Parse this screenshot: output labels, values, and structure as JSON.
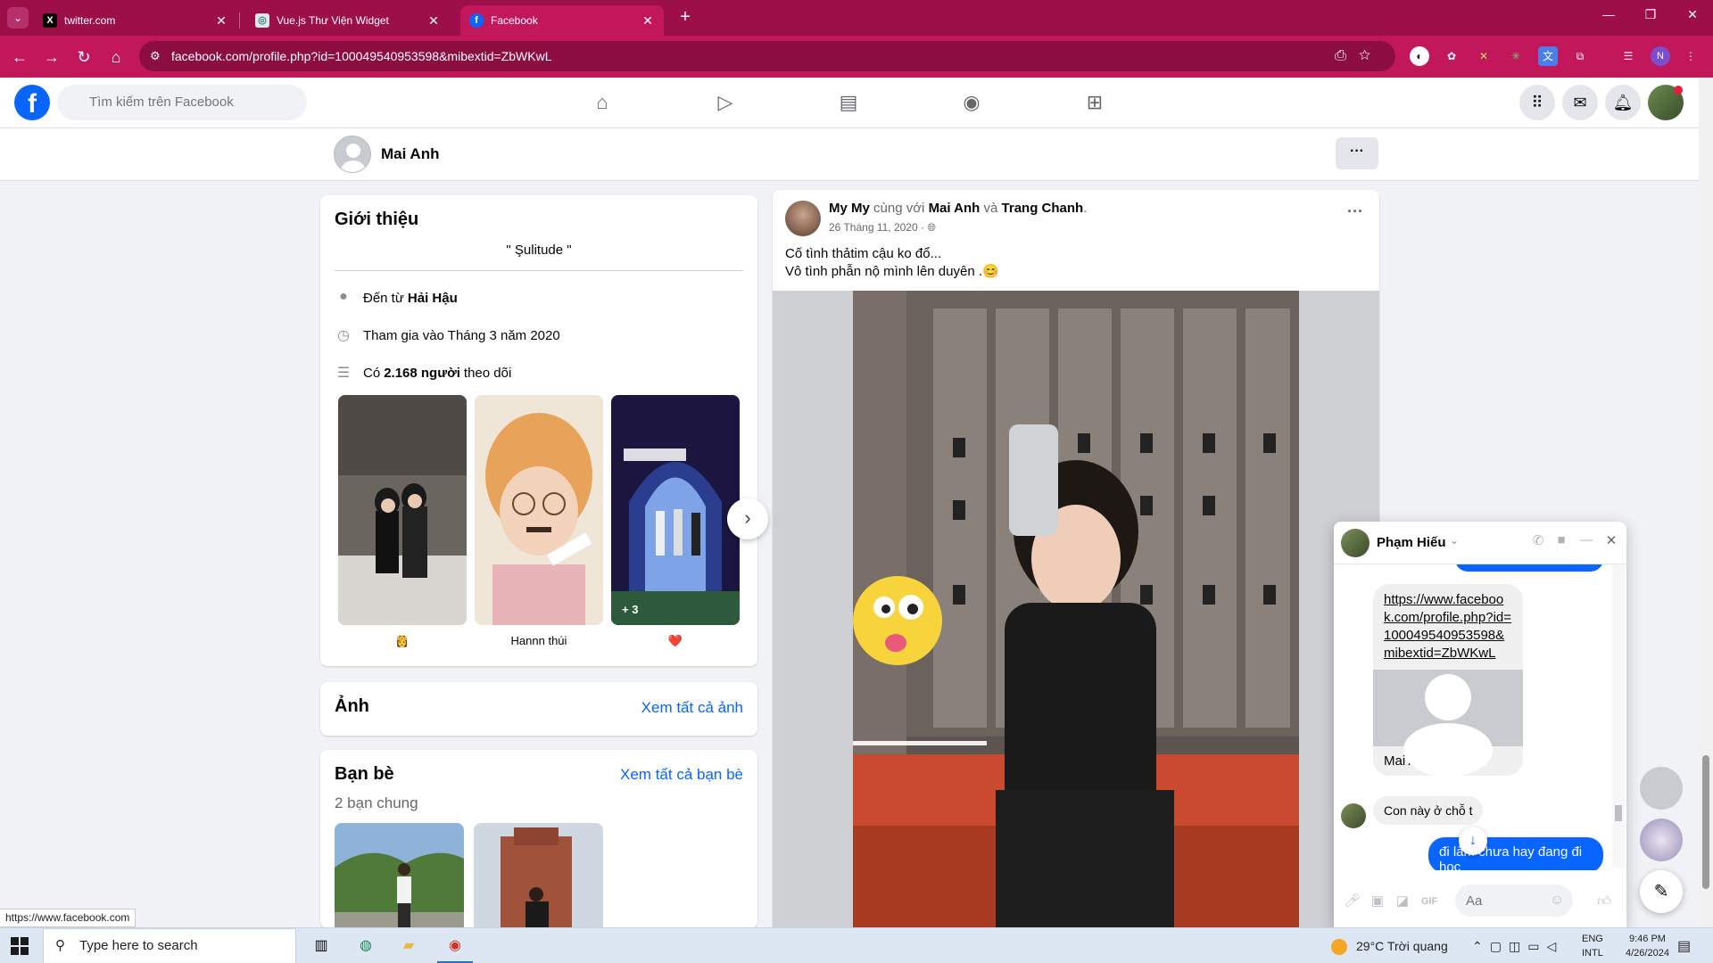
{
  "browser": {
    "tabs": [
      {
        "title": "twitter.com",
        "favicon": "x-icon"
      },
      {
        "title": "Vue.js Thư Viện Widget",
        "favicon": "vue-icon"
      },
      {
        "title": "Facebook",
        "favicon": "facebook-icon",
        "active": true
      }
    ],
    "url": "facebook.com/profile.php?id=100049540953598&mibextid=ZbWKwL",
    "profile_initial": "N",
    "status_url": "https://www.facebook.com",
    "accent": "#c2185b"
  },
  "fb": {
    "search_placeholder": "Tìm kiếm trên Facebook",
    "nav_icons": [
      "home-icon",
      "video-icon",
      "marketplace-icon",
      "groups-icon",
      "gaming-icon"
    ],
    "accent": "#0866ff"
  },
  "profile": {
    "name": "Mai Anh"
  },
  "intro": {
    "title": "Giới thiệu",
    "bio": "\" Şulitude \"",
    "from_prefix": "Đến từ",
    "from_place": "Hải Hậu",
    "joined": "Tham gia vào Tháng 3 năm 2020",
    "followers_prefix": "Có",
    "followers_count": "2.168 người",
    "followers_suffix": "theo dõi",
    "featured": [
      {
        "caption": "👸"
      },
      {
        "caption": "Hannn thúi"
      },
      {
        "caption": "❤️",
        "more": "+ 3"
      }
    ]
  },
  "photos": {
    "title": "Ảnh",
    "see_all": "Xem tất cả ảnh"
  },
  "friends": {
    "title": "Bạn bè",
    "mutual": "2 bạn chung",
    "see_all": "Xem tất cả bạn bè"
  },
  "post": {
    "author": "My My",
    "with_text": "cùng với",
    "tag1": "Mai Anh",
    "and_text": "và",
    "tag2": "Trang Chanh",
    "date": "26 Tháng 11, 2020 ·",
    "line1": "Cố tình thảtim cậu ko đổ...",
    "line2": "Vô tình phẫn nộ mình lên duyên .😊"
  },
  "chat": {
    "contact": "Phạm Hiếu",
    "link_url": "https://www.facebook.com/profile.php?id=100049540953598&mibextid=ZbWKwL",
    "link_name": "Mai Anh",
    "received": "Con này ở chỗ t",
    "sent": "đi làm chưa hay đang đi học",
    "input_placeholder": "Aa"
  },
  "taskbar": {
    "search_placeholder": "Type here to search",
    "weather": "29°C  Trời quang",
    "lang_top": "ENG",
    "lang_bottom": "INTL",
    "time": "9:46 PM",
    "date": "4/26/2024"
  }
}
